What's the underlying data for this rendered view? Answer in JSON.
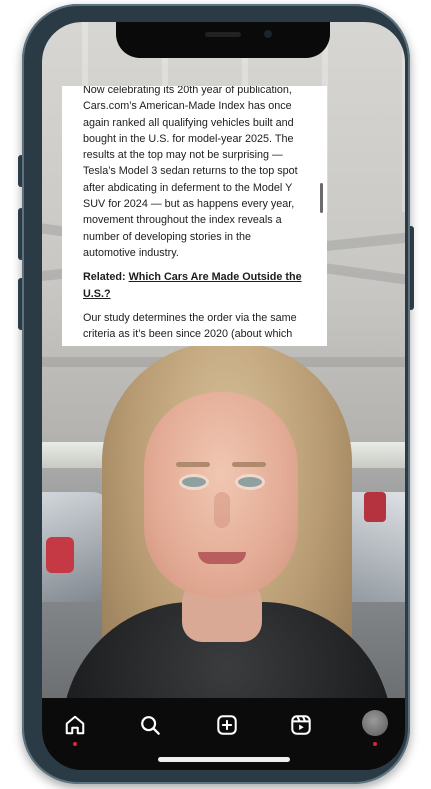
{
  "article": {
    "paragraph_1": "Now celebrating its 20th year of publication, Cars.com’s American-Made Index has once again ranked all qualifying vehicles built and bought in the U.S. for model-year 2025. The results at the top may not be surprising — Tesla’s Model 3 sedan returns to the top spot after abdicating in deferment to the Model Y SUV for 2024 — but as happens every year, movement throughout the index reveals a number of developing stories in the automotive industry.",
    "related_label": "Related:",
    "related_link": "Which Cars Are Made Outside the U.S.?",
    "paragraph_3": "Our study determines the order via the same criteria as it’s been since 2020 (about which"
  },
  "nav": {
    "items": [
      "home-icon",
      "search-icon",
      "create-icon",
      "reels-icon",
      "profile-avatar"
    ]
  },
  "colors": {
    "nav_background": "#0b0b0b",
    "notification_dot": "#e0233d",
    "phone_frame": "#2a3b46"
  }
}
